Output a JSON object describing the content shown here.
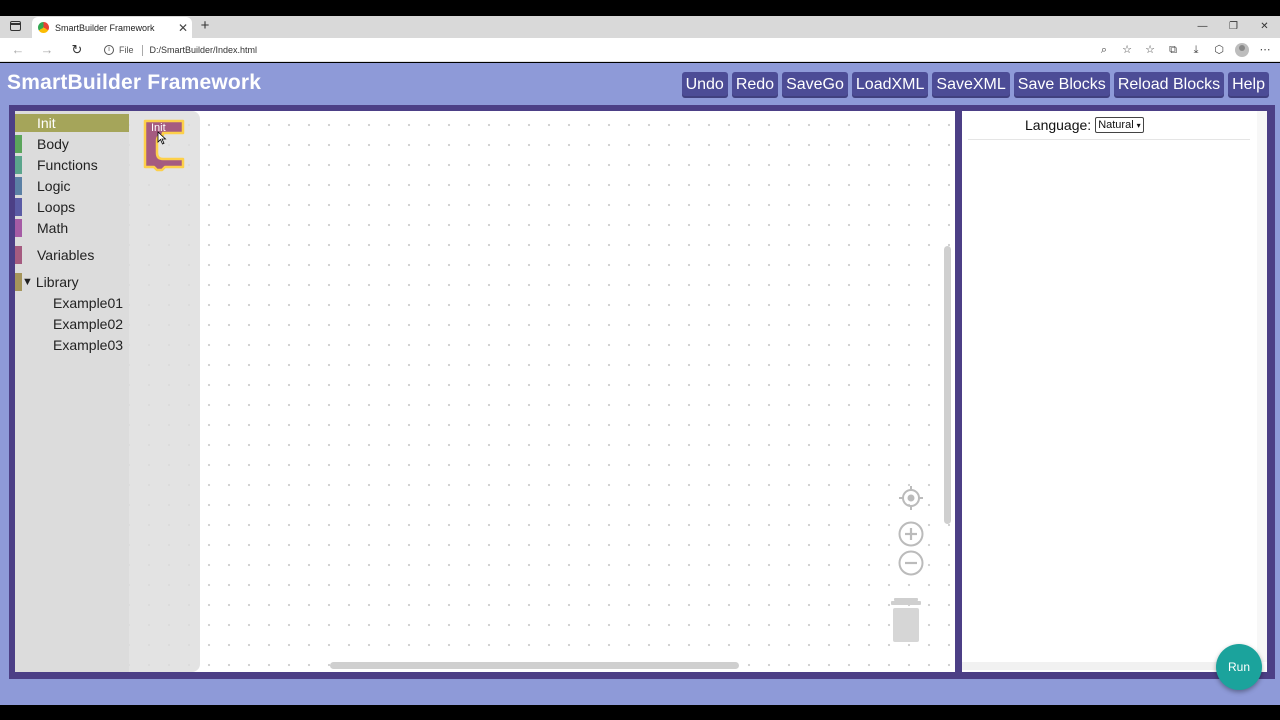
{
  "browser": {
    "tab_title": "SmartBuilder Framework",
    "tab_close": "✕",
    "new_tab": "+",
    "url_scheme": "File",
    "url_path": "D:/SmartBuilder/Index.html",
    "win_minimize": "—",
    "win_restore": "❐",
    "win_close": "✕"
  },
  "app": {
    "title": "SmartBuilder Framework",
    "buttons": [
      "Undo",
      "Redo",
      "SaveGo",
      "LoadXML",
      "SaveXML",
      "Save Blocks",
      "Reload Blocks",
      "Help"
    ]
  },
  "toolbox": {
    "categories": [
      {
        "label": "Init",
        "color": "#a5a55a",
        "selected": true
      },
      {
        "label": "Body",
        "color": "#5ba55b"
      },
      {
        "label": "Functions",
        "color": "#5ba58c"
      },
      {
        "label": "Logic",
        "color": "#5b80a5"
      },
      {
        "label": "Loops",
        "color": "#5b5ba5"
      },
      {
        "label": "Math",
        "color": "#a55ba5"
      },
      {
        "label": "Variables",
        "color": "#a55b80"
      },
      {
        "label": "Library",
        "color": "#a5955b",
        "expanded": true
      }
    ],
    "library_items": [
      "Example01",
      "Example02",
      "Example03"
    ]
  },
  "flyout": {
    "block_label": "Init",
    "block_color": "#a55b80",
    "highlight_color": "#fdd04a"
  },
  "code_panel": {
    "language_label": "Language:",
    "language_value": "Natural"
  },
  "run_button": "Run"
}
